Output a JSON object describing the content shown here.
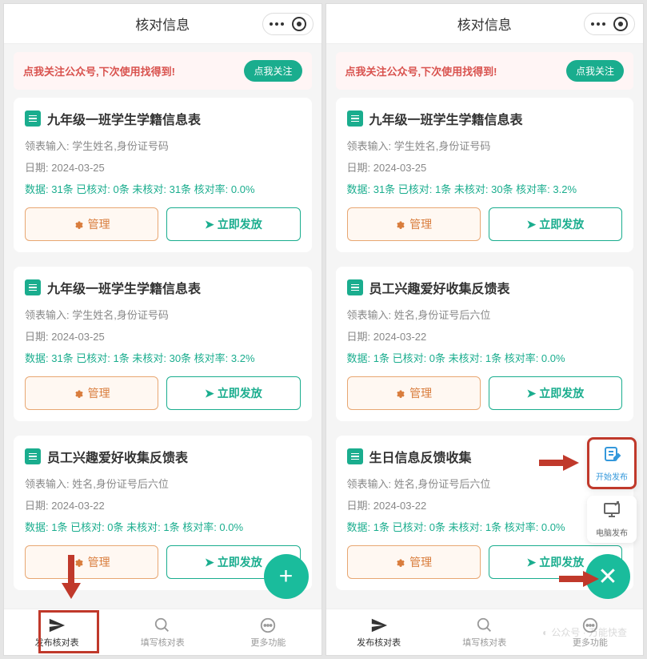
{
  "header": {
    "title": "核对信息"
  },
  "banner": {
    "text": "点我关注公众号,下次使用找得到!",
    "btn": "点我关注"
  },
  "left": {
    "cards": [
      {
        "title": "九年级一班学生学籍信息表",
        "input_label": "领表输入:",
        "input_value": "学生姓名,身份证号码",
        "date_label": "日期:",
        "date_value": "2024-03-25",
        "data": "数据: 31条 已核对: 0条 未核对: 31条 核对率: 0.0%",
        "manage": "管理",
        "publish": "立即发放"
      },
      {
        "title": "九年级一班学生学籍信息表",
        "input_label": "领表输入:",
        "input_value": "学生姓名,身份证号码",
        "date_label": "日期:",
        "date_value": "2024-03-25",
        "data": "数据: 31条 已核对: 1条 未核对: 30条 核对率: 3.2%",
        "manage": "管理",
        "publish": "立即发放"
      },
      {
        "title": "员工兴趣爱好收集反馈表",
        "input_label": "领表输入:",
        "input_value": "姓名,身份证号后六位",
        "date_label": "日期:",
        "date_value": "2024-03-22",
        "data": "数据: 1条 已核对: 0条 未核对: 1条 核对率: 0.0%",
        "manage": "管理",
        "publish": "立即发放"
      }
    ]
  },
  "right": {
    "cards": [
      {
        "title": "九年级一班学生学籍信息表",
        "input_label": "领表输入:",
        "input_value": "学生姓名,身份证号码",
        "date_label": "日期:",
        "date_value": "2024-03-25",
        "data": "数据: 31条 已核对: 1条 未核对: 30条 核对率: 3.2%",
        "manage": "管理",
        "publish": "立即发放"
      },
      {
        "title": "员工兴趣爱好收集反馈表",
        "input_label": "领表输入:",
        "input_value": "姓名,身份证号后六位",
        "date_label": "日期:",
        "date_value": "2024-03-22",
        "data": "数据: 1条 已核对: 0条 未核对: 1条 核对率: 0.0%",
        "manage": "管理",
        "publish": "立即发放"
      },
      {
        "title": "生日信息反馈收集",
        "input_label": "领表输入:",
        "input_value": "姓名,身份证号后六位",
        "date_label": "日期:",
        "date_value": "2024-03-22",
        "data": "数据: 1条 已核对: 0条 未核对: 1条 核对率: 0.0%",
        "manage": "管理",
        "publish": "立即发放"
      }
    ],
    "float_menu": [
      {
        "label": "开始发布",
        "icon": "📝"
      },
      {
        "label": "电脑发布",
        "icon": "🖥"
      }
    ]
  },
  "tabs": [
    {
      "label": "发布核对表"
    },
    {
      "label": "填写核对表"
    },
    {
      "label": "更多功能"
    }
  ],
  "watermark": "公众号 · 万能快查"
}
